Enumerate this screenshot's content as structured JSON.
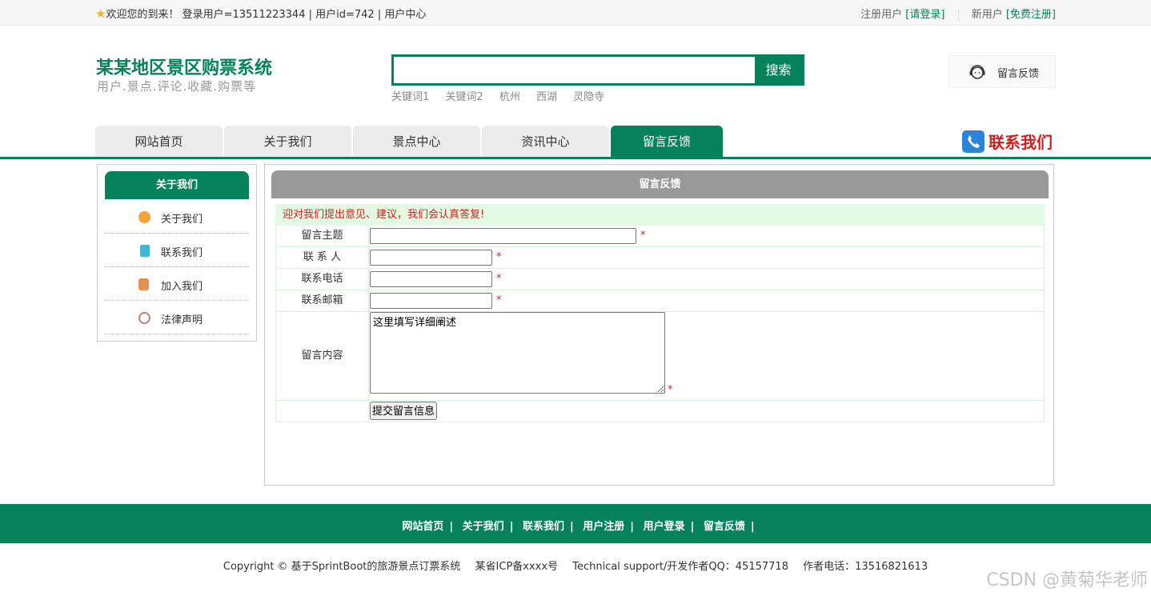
{
  "topbar": {
    "welcome": "欢迎您的到来！ 登录用户=13511223344 | 用户id=742 | 用户中心",
    "register_user_label": "注册用户",
    "login_link": "[请登录]",
    "new_user_label": "新用户",
    "free_register_link": "[免费注册]"
  },
  "header": {
    "title": "某某地区景区购票系统",
    "subtitle": "用户.景点.评论.收藏.购票等"
  },
  "search": {
    "value": "",
    "button": "搜索",
    "keywords": [
      "关键词1",
      "关键词2",
      "杭州",
      "西湖",
      "灵隐寺"
    ]
  },
  "feedback_box": {
    "label": "留言反馈"
  },
  "nav": {
    "tabs": [
      "网站首页",
      "关于我们",
      "景点中心",
      "资讯中心",
      "留言反馈"
    ],
    "active": "留言反馈",
    "contact": "联系我们"
  },
  "sidebar": {
    "title": "关于我们",
    "items": [
      {
        "label": "关于我们",
        "icon": "coin-icon",
        "color": "#f5a33a"
      },
      {
        "label": "联系我们",
        "icon": "clipboard-icon",
        "color": "#3fb6d8"
      },
      {
        "label": "加入我们",
        "icon": "lock-icon",
        "color": "#e8904f"
      },
      {
        "label": "法律声明",
        "icon": "power-icon",
        "color": "#c97b7b"
      }
    ]
  },
  "form": {
    "title": "留言反馈",
    "notice": "迎对我们提出意见、建议，我们会认真答复!",
    "subject_label": "留言主题",
    "contact_label": "联 系 人",
    "phone_label": "联系电话",
    "email_label": "联系邮箱",
    "content_label": "留言内容",
    "content_value": "这里填写详细阐述",
    "required_mark": "*",
    "submit": "提交留言信息"
  },
  "footer": {
    "links": [
      "网站首页",
      "关于我们",
      "联系我们",
      "用户注册",
      "用户登录",
      "留言反馈"
    ],
    "separator": "|",
    "copyright": "Copyright © 基于SprintBoot的旅游景点订票系统",
    "icp": "某省ICP备xxxx号",
    "support": "Technical support/开发作者QQ：45157718",
    "phone": "作者电话：13516821613"
  },
  "watermark": "CSDN @黄菊华老师",
  "colors": {
    "brand": "#06825a",
    "accent_red": "#d41e1e",
    "notice_bg": "#e3fbe3",
    "header_gray": "#999999"
  }
}
